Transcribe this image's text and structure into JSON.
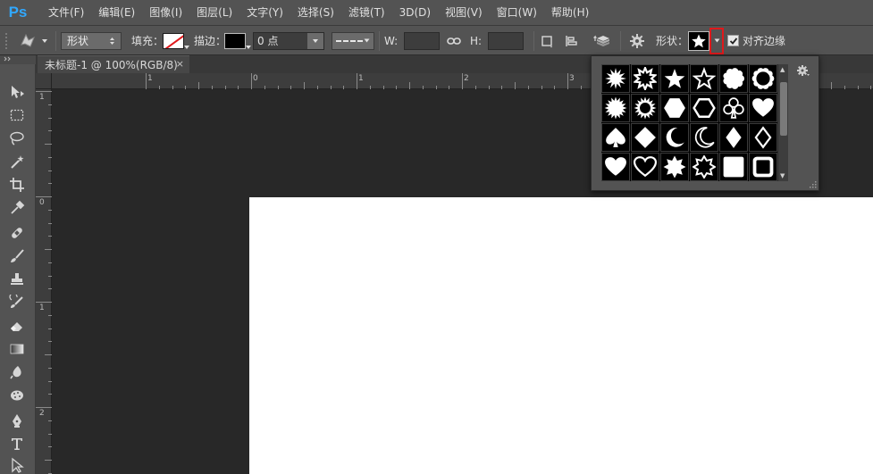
{
  "app": {
    "logo": "Ps"
  },
  "menu": [
    "文件(F)",
    "编辑(E)",
    "图像(I)",
    "图层(L)",
    "文字(Y)",
    "选择(S)",
    "滤镜(T)",
    "3D(D)",
    "视图(V)",
    "窗口(W)",
    "帮助(H)"
  ],
  "options": {
    "mode_value": "形状",
    "fill_label": "填充：",
    "stroke_label": "描边：",
    "stroke_width_value": "0 点",
    "w_label": "W:",
    "h_label": "H:",
    "shape_label": "形状：",
    "align_edges_label": "对齐边缘",
    "align_edges_checked": true
  },
  "document": {
    "tab_title": "未标题-1 @ 100%(RGB/8)",
    "tab_close": "×"
  },
  "rulers": {
    "top_labels": [
      "1",
      "0",
      "1",
      "2",
      "3"
    ],
    "left_labels": [
      "1",
      "0",
      "1",
      "2"
    ]
  },
  "colors": {
    "accent_highlight": "#e0191c",
    "ps_blue": "#31a8ff",
    "canvas": "#ffffff"
  },
  "shape_picker": {
    "shapes": [
      "burst-8-icon",
      "burst-12-icon",
      "star-filled-icon",
      "star-outline-icon",
      "scallop-filled-icon",
      "scallop-outline-icon",
      "burst-16-icon",
      "burst-16-outline-icon",
      "hexagon-filled-icon",
      "hexagon-outline-icon",
      "club-icon",
      "heart-filled-icon",
      "spade-icon",
      "diamond-filled-icon",
      "crescent-filled-icon",
      "crescent-outline-icon",
      "diamond-tall-filled-icon",
      "diamond-tall-outline-icon",
      "heart-filled-icon",
      "heart-outline-icon",
      "star-8-filled-icon",
      "star-8-outline-icon",
      "rounded-square-filled-icon",
      "rounded-square-outline-icon"
    ]
  }
}
